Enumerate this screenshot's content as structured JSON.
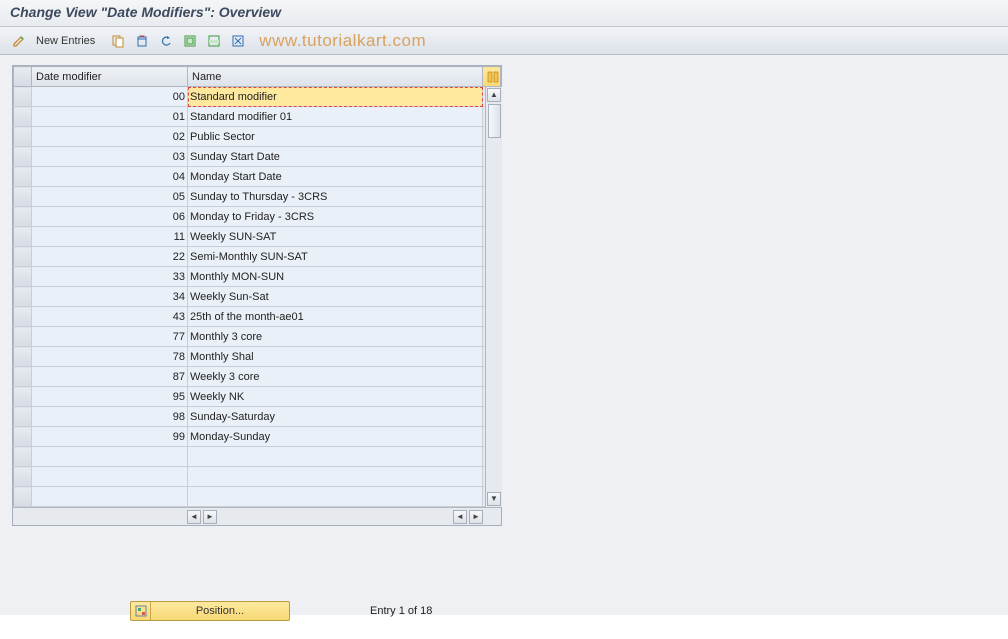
{
  "title": "Change View \"Date Modifiers\": Overview",
  "toolbar": {
    "new_entries_label": "New Entries"
  },
  "watermark": "www.tutorialkart.com",
  "columns": {
    "date_modifier": "Date modifier",
    "name": "Name"
  },
  "rows": [
    {
      "dm": "00",
      "name": "Standard modifier",
      "selected": true
    },
    {
      "dm": "01",
      "name": "Standard modifier 01"
    },
    {
      "dm": "02",
      "name": "Public Sector"
    },
    {
      "dm": "03",
      "name": "Sunday Start Date"
    },
    {
      "dm": "04",
      "name": "Monday Start Date"
    },
    {
      "dm": "05",
      "name": "Sunday to Thursday - 3CRS"
    },
    {
      "dm": "06",
      "name": "Monday to Friday - 3CRS"
    },
    {
      "dm": "11",
      "name": "Weekly SUN-SAT"
    },
    {
      "dm": "22",
      "name": "Semi-Monthly SUN-SAT"
    },
    {
      "dm": "33",
      "name": "Monthly MON-SUN"
    },
    {
      "dm": "34",
      "name": "Weekly Sun-Sat"
    },
    {
      "dm": "43",
      "name": "25th of the month-ae01"
    },
    {
      "dm": "77",
      "name": "Monthly 3 core"
    },
    {
      "dm": "78",
      "name": "Monthly Shal"
    },
    {
      "dm": "87",
      "name": "Weekly 3 core"
    },
    {
      "dm": "95",
      "name": "Weekly NK"
    },
    {
      "dm": "98",
      "name": "Sunday-Saturday"
    },
    {
      "dm": "99",
      "name": "Monday-Sunday"
    },
    {
      "dm": "",
      "name": ""
    },
    {
      "dm": "",
      "name": ""
    },
    {
      "dm": "",
      "name": ""
    }
  ],
  "footer": {
    "position_label": "Position...",
    "entry_text": "Entry 1 of 18"
  }
}
